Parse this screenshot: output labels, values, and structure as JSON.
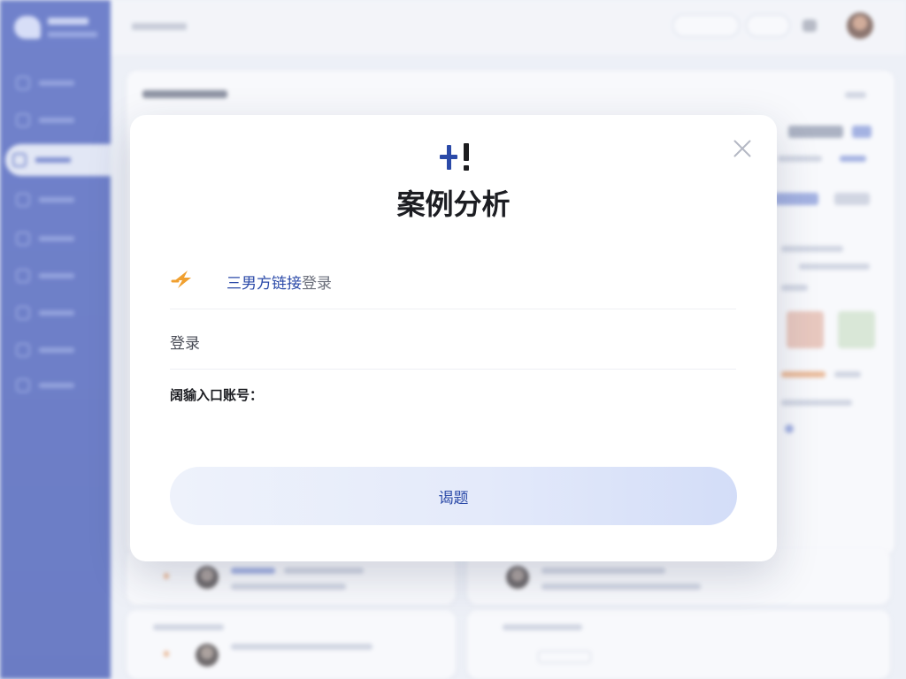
{
  "modal": {
    "title": "案例分析",
    "option_1": {
      "text_before_link": "",
      "link": "三男方链接",
      "text_after_link": "登录"
    },
    "option_2": {
      "label": "登录",
      "text": ""
    },
    "section_heading": "阔貐入口账号：",
    "description_line_1": "",
    "description_line_2": "",
    "confirm_button": "谒题"
  },
  "colors": {
    "sidebar": "#2f48b4",
    "brand_blue": "#2b4aa8",
    "accent_orange": "#f0a030",
    "button_gradient_end": "#d3ddf8"
  },
  "icons": {
    "close": "close-icon",
    "logo": "plus-exclamation-logo-icon",
    "option_1": "lightning-icon"
  }
}
